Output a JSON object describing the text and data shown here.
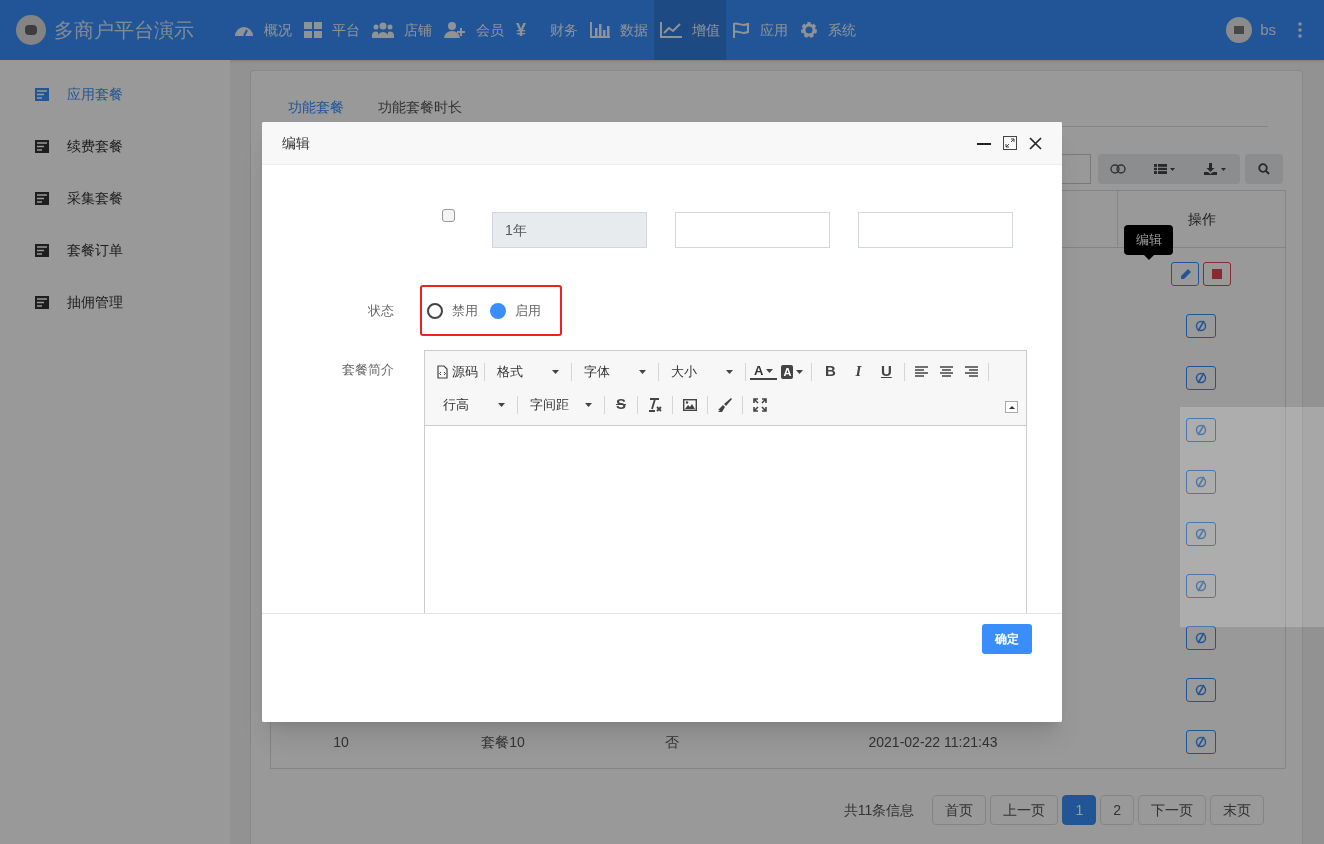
{
  "header": {
    "brand": "多商户平台演示",
    "nav": [
      {
        "label": "概况",
        "selected": false
      },
      {
        "label": "平台",
        "selected": false
      },
      {
        "label": "店铺",
        "selected": false
      },
      {
        "label": "会员",
        "selected": false
      },
      {
        "label": "财务",
        "glyph": "¥",
        "selected": false
      },
      {
        "label": "数据",
        "selected": false
      },
      {
        "label": "增值",
        "selected": true
      },
      {
        "label": "应用",
        "selected": false
      },
      {
        "label": "系统",
        "selected": false
      }
    ],
    "user": "bs"
  },
  "sidebar": {
    "items": [
      {
        "label": "应用套餐",
        "selected": true
      },
      {
        "label": "续费套餐",
        "selected": false
      },
      {
        "label": "采集套餐",
        "selected": false
      },
      {
        "label": "套餐订单",
        "selected": false
      },
      {
        "label": "抽佣管理",
        "selected": false
      }
    ]
  },
  "tabs": [
    {
      "label": "功能套餐",
      "selected": true
    },
    {
      "label": "功能套餐时长",
      "selected": false
    }
  ],
  "table": {
    "columns": [
      "操作"
    ],
    "rows": [
      {
        "actions": [
          {
            "kind": "edit"
          },
          {
            "kind": "stop"
          }
        ]
      },
      {
        "actions": [
          {
            "kind": "toggle"
          }
        ]
      },
      {
        "actions": [
          {
            "kind": "toggle"
          }
        ]
      },
      {
        "actions": [
          {
            "kind": "toggle"
          }
        ]
      },
      {
        "actions": [
          {
            "kind": "toggle"
          }
        ]
      },
      {
        "actions": [
          {
            "kind": "toggle"
          }
        ]
      },
      {
        "actions": [
          {
            "kind": "toggle"
          }
        ]
      },
      {
        "actions": [
          {
            "kind": "toggle"
          }
        ]
      },
      {
        "actions": [
          {
            "kind": "toggle"
          }
        ]
      },
      {
        "cells": [
          "10",
          "套餐10",
          "否",
          "2021-02-22 11:21:43"
        ],
        "actions": [
          {
            "kind": "toggle"
          }
        ]
      }
    ]
  },
  "tooltip": "编辑",
  "pagination": {
    "summary": "共11条信息",
    "buttons": [
      {
        "label": "首页",
        "selected": false
      },
      {
        "label": "上一页",
        "selected": false
      },
      {
        "label": "1",
        "selected": true
      },
      {
        "label": "2",
        "selected": false
      },
      {
        "label": "下一页",
        "selected": false
      },
      {
        "label": "末页",
        "selected": false
      }
    ]
  },
  "modal": {
    "title": "编辑",
    "period": {
      "checked": false,
      "fields": [
        {
          "value": "1年",
          "disabled": true
        },
        {
          "disabled": false
        },
        {
          "disabled": false
        }
      ]
    },
    "status": {
      "label": "状态",
      "options": [
        {
          "label": "禁用",
          "selected": false
        },
        {
          "label": "启用",
          "selected": true
        }
      ]
    },
    "intro": {
      "label": "套餐简介",
      "toolbar": [
        [
          {
            "kind": "source",
            "text": "源码"
          },
          {
            "kind": "sep"
          },
          {
            "kind": "select",
            "text": "格式"
          },
          {
            "kind": "sep"
          },
          {
            "kind": "select",
            "text": "字体"
          },
          {
            "kind": "sep"
          },
          {
            "kind": "select",
            "text": "大小"
          },
          {
            "kind": "sep"
          },
          {
            "kind": "color",
            "text": "A"
          },
          {
            "kind": "bgcolor",
            "text": "A"
          },
          {
            "kind": "sep"
          },
          {
            "kind": "bold",
            "text": "B"
          },
          {
            "kind": "italic",
            "text": "I"
          },
          {
            "kind": "underline",
            "text": "U"
          },
          {
            "kind": "sep"
          },
          {
            "kind": "align-left"
          },
          {
            "kind": "align-center"
          },
          {
            "kind": "align-right"
          },
          {
            "kind": "sep"
          }
        ],
        [
          {
            "kind": "select",
            "text": "行高"
          },
          {
            "kind": "sep"
          },
          {
            "kind": "select",
            "text": "字间距"
          },
          {
            "kind": "sep"
          },
          {
            "kind": "strike",
            "text": "S"
          },
          {
            "kind": "sep"
          },
          {
            "kind": "clear"
          },
          {
            "kind": "sep"
          },
          {
            "kind": "image"
          },
          {
            "kind": "sep"
          },
          {
            "kind": "brush"
          },
          {
            "kind": "sep"
          },
          {
            "kind": "fullscreen"
          }
        ]
      ]
    },
    "submit": "确定"
  }
}
